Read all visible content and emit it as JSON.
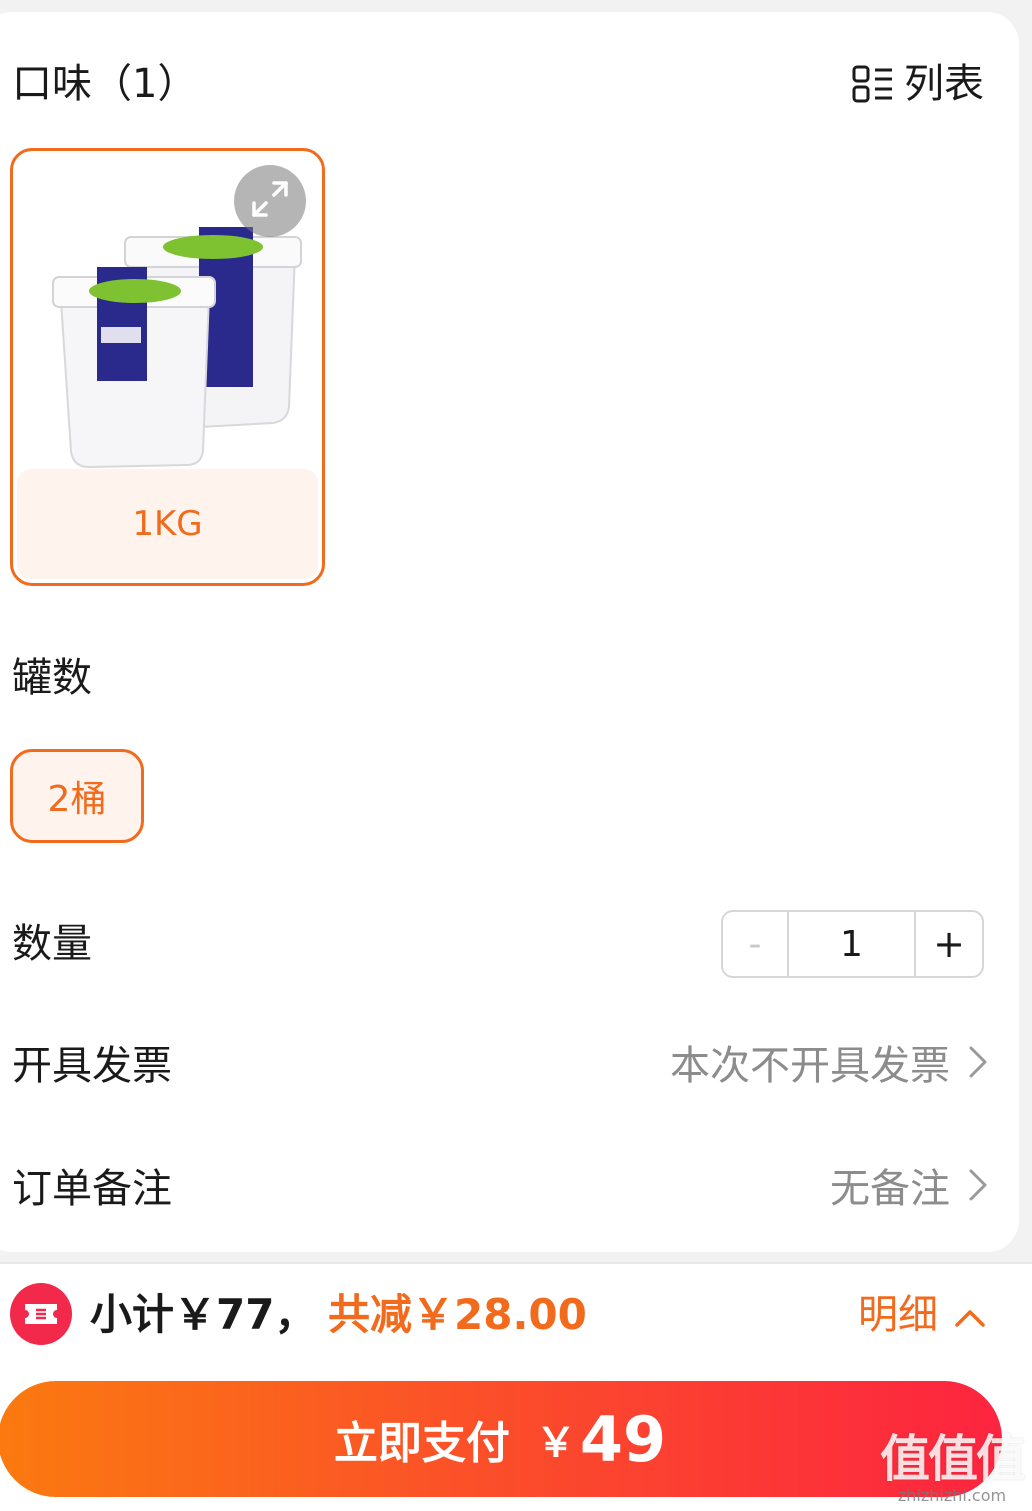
{
  "spec": {
    "flavor_title": "口味（1）",
    "view_toggle_label": "列表",
    "sku_options": [
      {
        "label": "1KG",
        "selected": true,
        "image": "two-yogurt-tubs"
      }
    ],
    "can_count_title": "罐数",
    "can_count_options": [
      {
        "label": "2桶",
        "selected": true
      }
    ]
  },
  "quantity": {
    "label": "数量",
    "minus": "-",
    "value": "1",
    "plus": "+"
  },
  "invoice": {
    "label": "开具发票",
    "value": "本次不开具发票"
  },
  "note": {
    "label": "订单备注",
    "value": "无备注"
  },
  "footer": {
    "subtotal": "小计￥77，",
    "discount": "共减￥28.00",
    "detail_label": "明细",
    "pay_label": "立即支付",
    "pay_currency": "￥",
    "pay_amount": "49"
  },
  "watermark": {
    "main": "值值值",
    "sub": "zhizhizhi.com"
  },
  "colors": {
    "accent": "#f26a1b",
    "pay_gradient_start": "#fb7a10",
    "pay_gradient_end": "#fd2440",
    "coupon_red": "#f2294b",
    "muted_text": "#8c8c8c"
  },
  "icons": [
    "grid-list-icon",
    "expand-icon",
    "chevron-right-icon",
    "chevron-up-icon",
    "coupon-icon"
  ]
}
